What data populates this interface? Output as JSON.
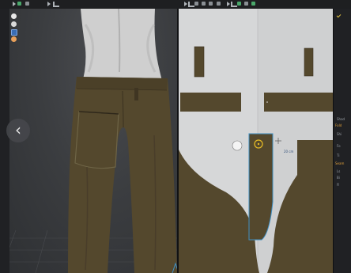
{
  "toolbar": {
    "left_tools": [
      "play-icon",
      "list-icon",
      "transform-icon",
      "select-icon",
      "move-icon"
    ],
    "center_tools": [
      "play-icon",
      "select-icon",
      "fold-icon",
      "edit-icon",
      "segment-icon",
      "curve-icon"
    ],
    "right_tools": [
      "play-icon",
      "select-icon",
      "layer-icon",
      "arrange-icon",
      "sewing-icon"
    ]
  },
  "viewport": {
    "side_icons": [
      "avatar-icon",
      "light-icon",
      "display-icon",
      "texture-icon"
    ],
    "back_label": "‹",
    "garment_color": "#54482d",
    "skin_color": "#cfcfcf"
  },
  "pattern_window": {
    "fabric_color": "#54482d",
    "selected_piece_outline": "#3f8fc4",
    "measurement": "20 cm"
  },
  "right_panel": {
    "items": [
      {
        "text": "Shad"
      },
      {
        "text": "Fold",
        "accent": true
      },
      {
        "text": "Shi"
      },
      {
        "text": "Fo"
      },
      {
        "text": "Ti"
      },
      {
        "text": "Seam",
        "accent": true
      },
      {
        "text": "Ls"
      },
      {
        "text": "Bi"
      },
      {
        "text": "Fl"
      }
    ]
  }
}
